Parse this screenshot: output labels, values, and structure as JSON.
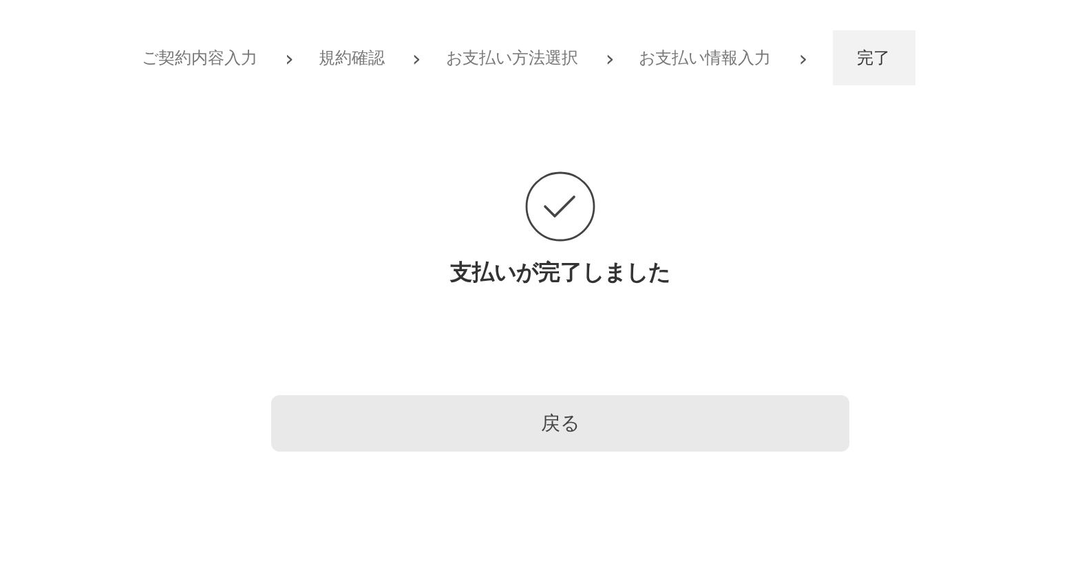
{
  "steps": [
    {
      "label": "ご契約内容入力",
      "selected": false,
      "separator": "›"
    },
    {
      "label": "規約確認",
      "selected": false,
      "separator": "›"
    },
    {
      "label": "お支払い方法選択",
      "selected": false,
      "separator": "›"
    },
    {
      "label": "お支払い情報入力",
      "selected": false,
      "separator": "›"
    },
    {
      "label": "完了",
      "selected": true
    }
  ],
  "message": "支払いが完了しました",
  "back_button": "戻る"
}
